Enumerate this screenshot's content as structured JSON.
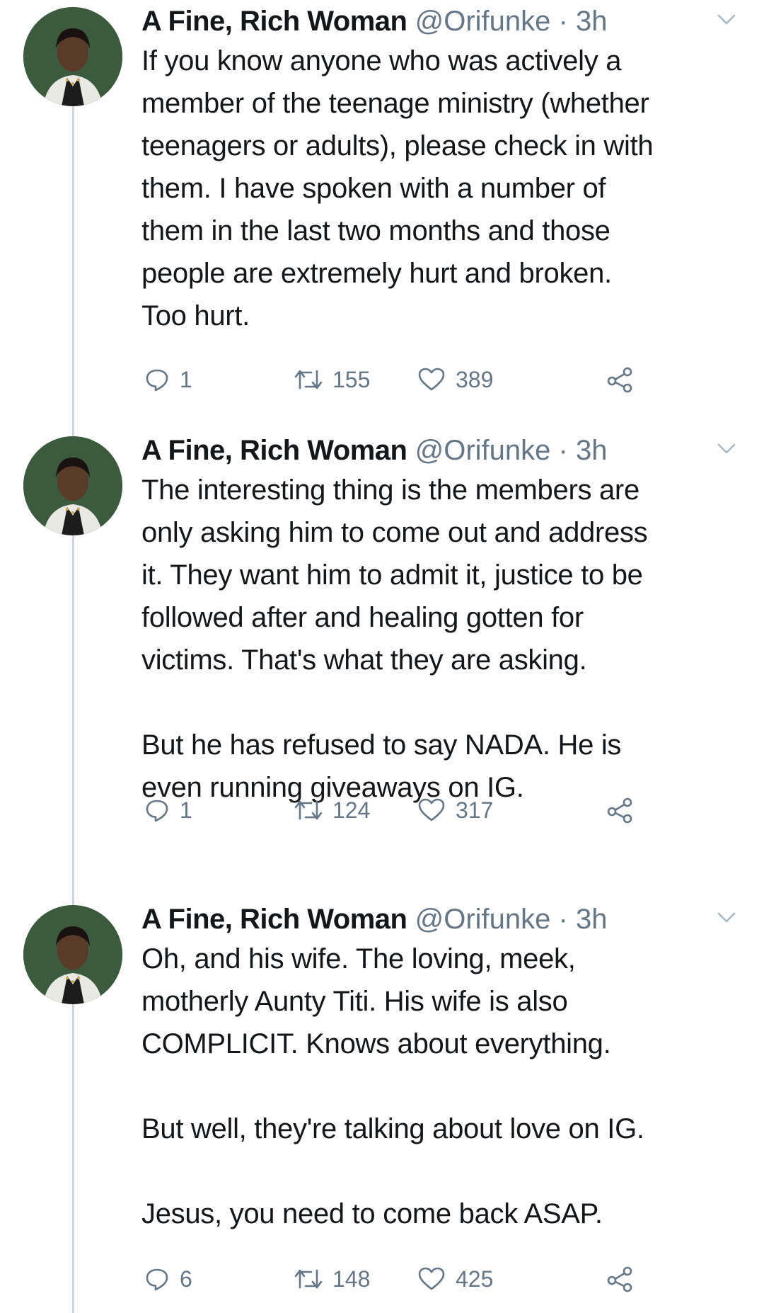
{
  "tweets": [
    {
      "author": "A Fine, Rich Woman",
      "handle": "@Orifunke",
      "separator": "·",
      "time": "3h",
      "paragraphs": [
        "If you know anyone who was actively a\nmember of the teenage ministry (whether\nteenagers or adults), please check in with\nthem. I have spoken with a number of\nthem in the last two months and those\npeople are extremely hurt and broken.\nToo hurt."
      ],
      "replies": "1",
      "retweets": "155",
      "likes": "389"
    },
    {
      "author": "A Fine, Rich Woman",
      "handle": "@Orifunke",
      "separator": "·",
      "time": "3h",
      "paragraphs": [
        "The interesting thing is the members are\nonly asking him to come out and address\nit. They want him to admit it, justice to be\nfollowed after and healing gotten for\nvictims. That's what they are asking.",
        "But he has refused to say NADA. He is\neven running giveaways on IG."
      ],
      "replies": "1",
      "retweets": "124",
      "likes": "317"
    },
    {
      "author": "A Fine, Rich Woman",
      "handle": "@Orifunke",
      "separator": "·",
      "time": "3h",
      "paragraphs": [
        "Oh, and his wife. The loving, meek,\nmotherly Aunty Titi. His wife is also\nCOMPLICIT. Knows about everything.",
        "But well, they're talking about love on IG.",
        "Jesus, you need to come back ASAP."
      ],
      "replies": "6",
      "retweets": "148",
      "likes": "425"
    }
  ],
  "icons": {
    "reply": "reply-icon",
    "retweet": "retweet-icon",
    "like": "heart-icon",
    "share": "share-icon",
    "more": "chevron-down-icon"
  },
  "colors": {
    "text": "#14171a",
    "muted": "#657786",
    "thread_line": "#cdd6dd"
  }
}
